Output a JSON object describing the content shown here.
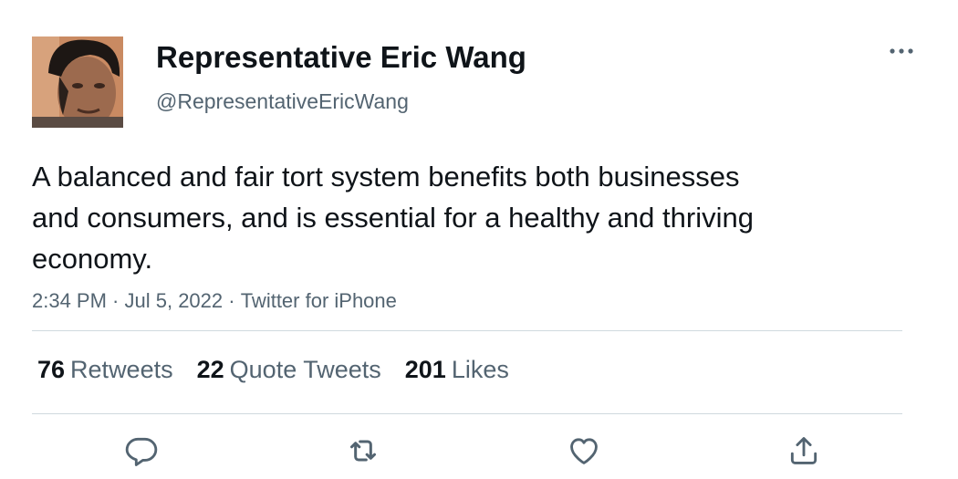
{
  "author": {
    "display_name": "Representative Eric Wang",
    "handle": "@RepresentativeEricWang",
    "avatar_icon": "profile-photo"
  },
  "tweet": {
    "text": "A balanced and fair tort system benefits both businesses and consumers, and is essential for a healthy and thriving economy.",
    "time": "2:34 PM",
    "separator_1": " · ",
    "date": "Jul 5, 2022",
    "separator_2": " · ",
    "source": "Twitter for iPhone"
  },
  "stats": {
    "retweets_count": "76",
    "retweets_label": "Retweets",
    "quotes_count": "22",
    "quotes_label": "Quote Tweets",
    "likes_count": "201",
    "likes_label": "Likes"
  },
  "icons": {
    "more": "more-dots-icon",
    "reply": "reply-icon",
    "retweet": "retweet-icon",
    "like": "heart-icon",
    "share": "share-icon"
  },
  "colors": {
    "text_primary": "#0f1419",
    "text_secondary": "#536471",
    "divider": "#cfd9de"
  }
}
